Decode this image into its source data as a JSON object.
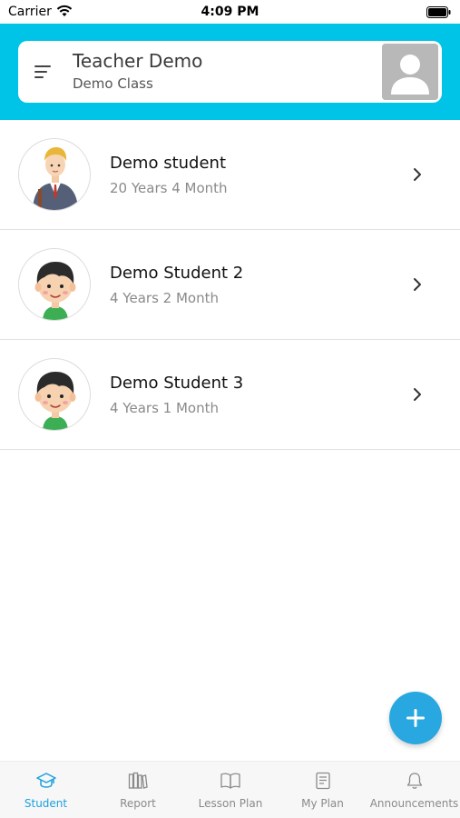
{
  "status_bar": {
    "carrier": "Carrier",
    "time": "4:09 PM"
  },
  "header": {
    "title": "Teacher Demo",
    "subtitle": "Demo Class",
    "menu_icon": "menu-icon",
    "avatar_icon": "user-placeholder-icon"
  },
  "students": [
    {
      "name": "Demo student",
      "age": "20 Years 4 Month",
      "avatar": "student-teen-avatar"
    },
    {
      "name": "Demo Student 2",
      "age": "4 Years 2 Month",
      "avatar": "student-child-avatar"
    },
    {
      "name": "Demo Student 3",
      "age": "4 Years 1 Month",
      "avatar": "student-child-avatar"
    }
  ],
  "fab": {
    "icon": "plus-icon"
  },
  "tabs": [
    {
      "label": "Student",
      "icon": "graduation-cap-icon",
      "active": true
    },
    {
      "label": "Report",
      "icon": "books-icon",
      "active": false
    },
    {
      "label": "Lesson Plan",
      "icon": "open-book-icon",
      "active": false
    },
    {
      "label": "My Plan",
      "icon": "notepad-icon",
      "active": false
    },
    {
      "label": "Announcements",
      "icon": "bell-icon",
      "active": false
    }
  ],
  "colors": {
    "header_band": "#00c3e8",
    "accent": "#1ba0de",
    "fab": "#29a7e1"
  }
}
